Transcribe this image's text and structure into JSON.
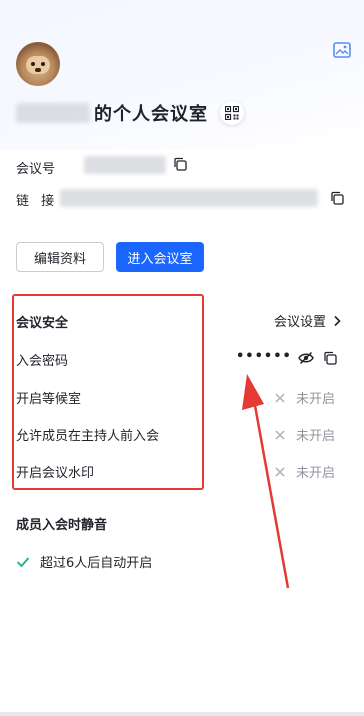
{
  "header": {
    "title_suffix": "的个人会议室"
  },
  "info": {
    "meeting_id_label": "会议号",
    "link_label": "链 接"
  },
  "actions": {
    "edit_label": "编辑资料",
    "enter_label": "进入会议室"
  },
  "security": {
    "section_title": "会议安全",
    "settings_label": "会议设置",
    "items": [
      {
        "label": "入会密码",
        "value": "••••••"
      },
      {
        "label": "开启等候室",
        "status": "未开启"
      },
      {
        "label": "允许成员在主持人前入会",
        "status": "未开启"
      },
      {
        "label": "开启会议水印",
        "status": "未开启"
      }
    ]
  },
  "mute": {
    "section_title": "成员入会时静音",
    "option_label": "超过6人后自动开启"
  },
  "colors": {
    "accent": "#1a66ff",
    "annotation_red": "#e53935",
    "muted_text": "#8f959e"
  }
}
